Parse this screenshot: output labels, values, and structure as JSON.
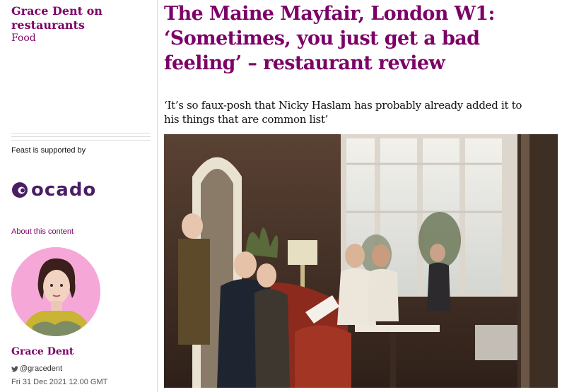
{
  "series": {
    "title": "Grace Dent on restaurants",
    "section": "Food"
  },
  "sponsor": {
    "label": "Feast is supported by",
    "brand": "ocado",
    "about": "About this content"
  },
  "author": {
    "name": "Grace Dent",
    "twitter": "@gracedent",
    "date": "Fri 31 Dec 2021 12.00 GMT"
  },
  "article": {
    "headline": "The Maine Mayfair, London W1: ‘Sometimes, you just get a bad feeling’ – restaurant review",
    "standfirst": "‘It’s so faux-posh that Nicky Haslam has probably already added it to his things that are common list’"
  },
  "colors": {
    "accent": "#7d0068",
    "ocado": "#4b1e64",
    "avatar_bg": "#f5a8d8"
  },
  "icons": {
    "twitter": "twitter-icon",
    "ocado_logo": "ocado-logo-icon"
  }
}
